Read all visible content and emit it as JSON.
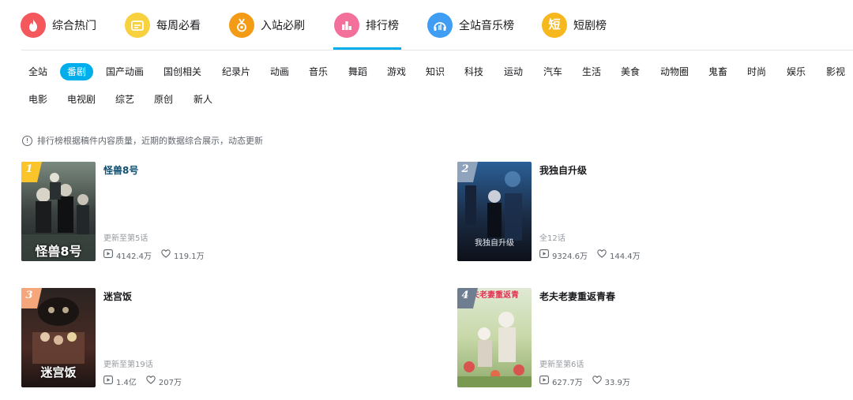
{
  "top_nav": [
    {
      "label": "综合热门",
      "icon": "flame-icon",
      "color": "#f4585c"
    },
    {
      "label": "每周必看",
      "icon": "calendar-icon",
      "color": "#f7d13e"
    },
    {
      "label": "入站必刷",
      "icon": "medal-icon",
      "color": "#f49b15"
    },
    {
      "label": "排行榜",
      "icon": "ranking-chart-icon",
      "color": "#f3709b"
    },
    {
      "label": "全站音乐榜",
      "icon": "music-icon",
      "color": "#3f9ef4"
    },
    {
      "label": "短剧榜",
      "icon": "short-drama-icon",
      "color": "#f7b71e",
      "glyph": "短"
    }
  ],
  "categories_row1": [
    "全站",
    "番剧",
    "国产动画",
    "国创相关",
    "纪录片",
    "动画",
    "音乐",
    "舞蹈",
    "游戏",
    "知识",
    "科技",
    "运动",
    "汽车",
    "生活",
    "美食",
    "动物圈",
    "鬼畜",
    "时尚",
    "娱乐",
    "影视"
  ],
  "categories_row2": [
    "电影",
    "电视剧",
    "综艺",
    "原创",
    "新人"
  ],
  "active_category": "番剧",
  "notice": "排行榜根据稿件内容质量，近期的数据综合展示，动态更新",
  "ranking": [
    {
      "rank": "1",
      "title": "怪兽8号",
      "cover_text": "怪兽8号",
      "update": "更新至第5话",
      "plays": "4142.4万",
      "likes": "119.1万",
      "badge_color": "#f9c52b"
    },
    {
      "rank": "2",
      "title": "我独自升级",
      "cover_text": "我独自升级",
      "update": "全12话",
      "plays": "9324.6万",
      "likes": "144.4万",
      "badge_color": "#8fa3bd"
    },
    {
      "rank": "3",
      "title": "迷宫饭",
      "cover_text": "迷宫饭",
      "update": "更新至第19话",
      "plays": "1.4亿",
      "likes": "207万",
      "badge_color": "#f6a67b"
    },
    {
      "rank": "4",
      "title": "老夫老妻重返青春",
      "cover_text": "老夫老妻重返青春",
      "update": "更新至第6话",
      "plays": "627.7万",
      "likes": "33.9万",
      "badge_color": "#6f7d90"
    }
  ]
}
